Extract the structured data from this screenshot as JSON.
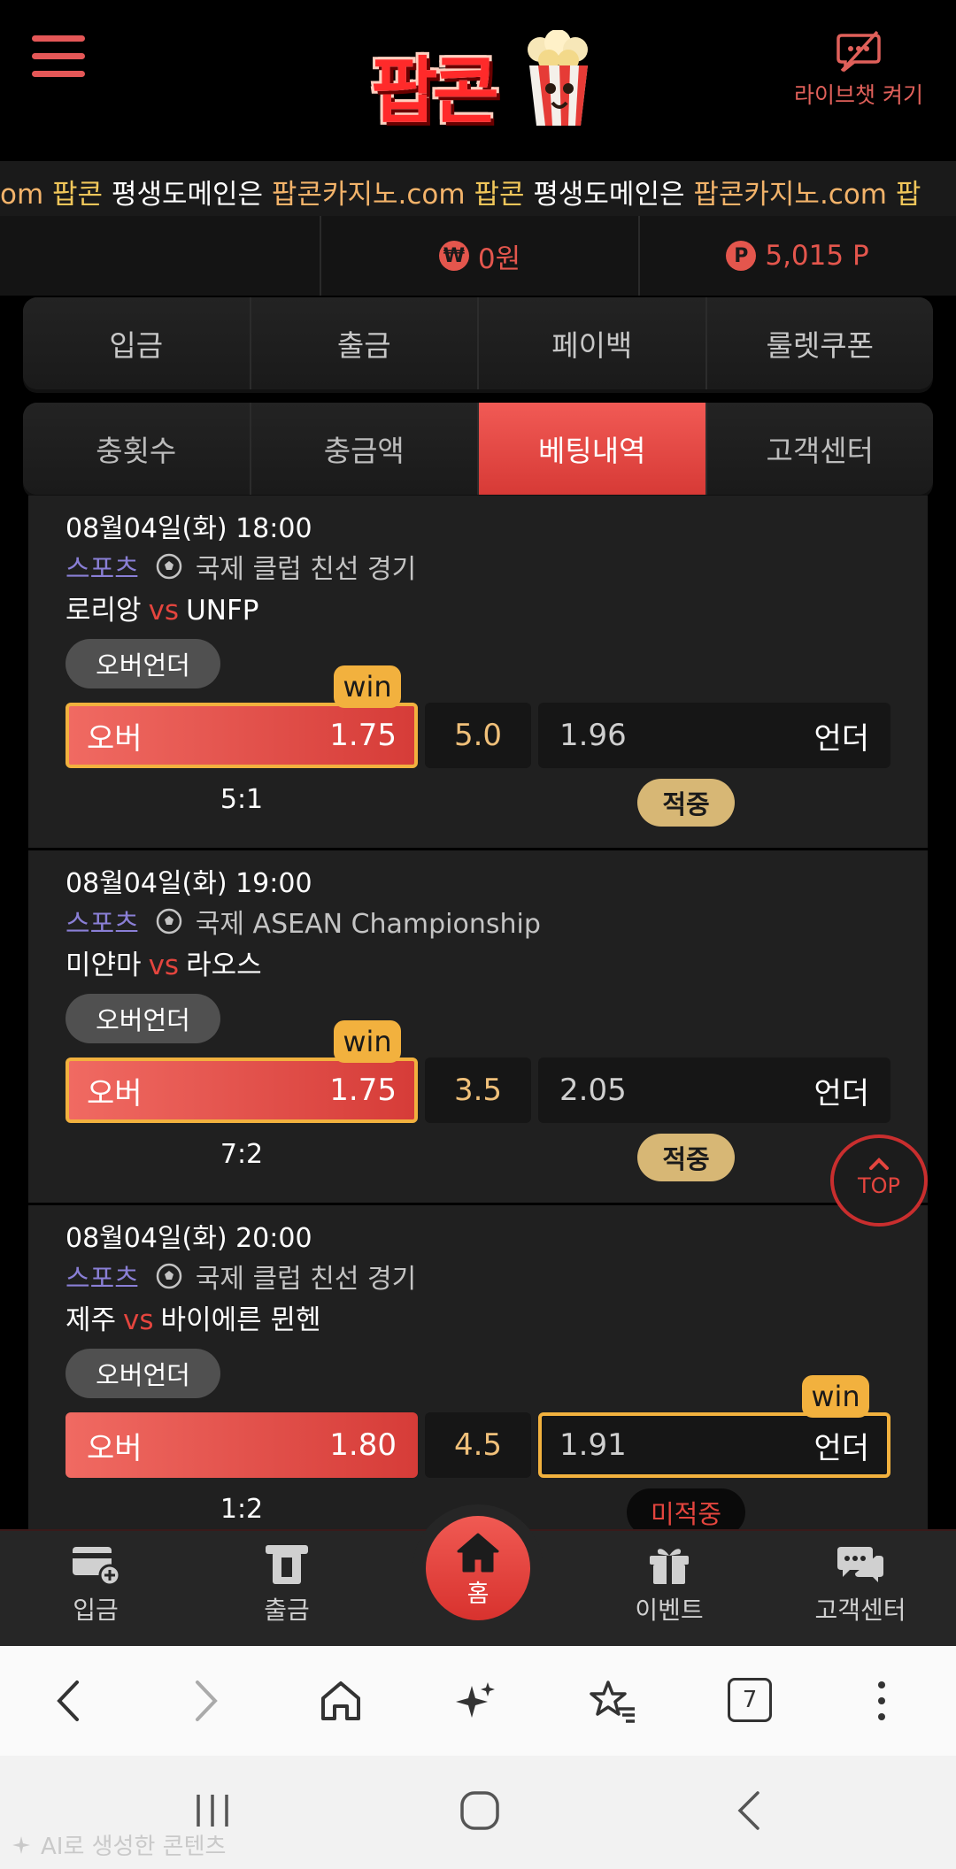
{
  "header": {
    "logo_text": "팝콘",
    "livechat_label": "라이브챗 켜기"
  },
  "marquee": {
    "items": [
      {
        "domain": "om",
        "brand": "팝콘",
        "text": "평생도메인은"
      },
      {
        "domain": "팝콘카지노.com",
        "brand": "팝콘",
        "text": "평생도메인은"
      },
      {
        "domain": "팝콘카지노.com",
        "brand": "팝",
        "text": ""
      }
    ]
  },
  "balance": {
    "cash_symbol": "₩",
    "cash": "0원",
    "point_symbol": "P",
    "points": "5,015 P"
  },
  "tabs_top": [
    "입금",
    "출금",
    "페이백",
    "룰렛쿠폰"
  ],
  "tabs_bottom": [
    "충횟수",
    "충금액",
    "베팅내역",
    "고객센터"
  ],
  "active_tab": "베팅내역",
  "bets": [
    {
      "datetime": "08월04일(화) 18:00",
      "sport": "스포츠",
      "league": "국제 클럽 친선 경기",
      "home": "로리앙",
      "vs": "vs",
      "away": "UNFP",
      "market": "오버언더",
      "over_label": "오버",
      "over_odd": "1.75",
      "line": "5.0",
      "under_odd": "1.96",
      "under_label": "언더",
      "win_badge": "win",
      "winner": "over",
      "score": "5:1",
      "result": "적중",
      "result_type": "hit"
    },
    {
      "datetime": "08월04일(화) 19:00",
      "sport": "스포츠",
      "league": "국제 ASEAN Championship",
      "home": "미얀마",
      "vs": "vs",
      "away": "라오스",
      "market": "오버언더",
      "over_label": "오버",
      "over_odd": "1.75",
      "line": "3.5",
      "under_odd": "2.05",
      "under_label": "언더",
      "win_badge": "win",
      "winner": "over",
      "score": "7:2",
      "result": "적중",
      "result_type": "hit"
    },
    {
      "datetime": "08월04일(화) 20:00",
      "sport": "스포츠",
      "league": "국제 클럽 친선 경기",
      "home": "제주",
      "vs": "vs",
      "away": "바이에른 뮌헨",
      "market": "오버언더",
      "over_label": "오버",
      "over_odd": "1.80",
      "line": "4.5",
      "under_odd": "1.91",
      "under_label": "언더",
      "win_badge": "win",
      "winner": "under",
      "score": "1:2",
      "result": "미적중",
      "result_type": "miss"
    }
  ],
  "top_button": "TOP",
  "bottom_nav": {
    "deposit": "입금",
    "withdraw": "출금",
    "home": "홈",
    "event": "이벤트",
    "support": "고객센터"
  },
  "browser": {
    "tab_count": "7"
  },
  "system": {
    "ai_note": "AI로 생성한 콘텐츠"
  },
  "colors": {
    "accent": "#e4453e",
    "gold": "#f2b13e",
    "hit": "#d7b775",
    "background": "#000000"
  }
}
